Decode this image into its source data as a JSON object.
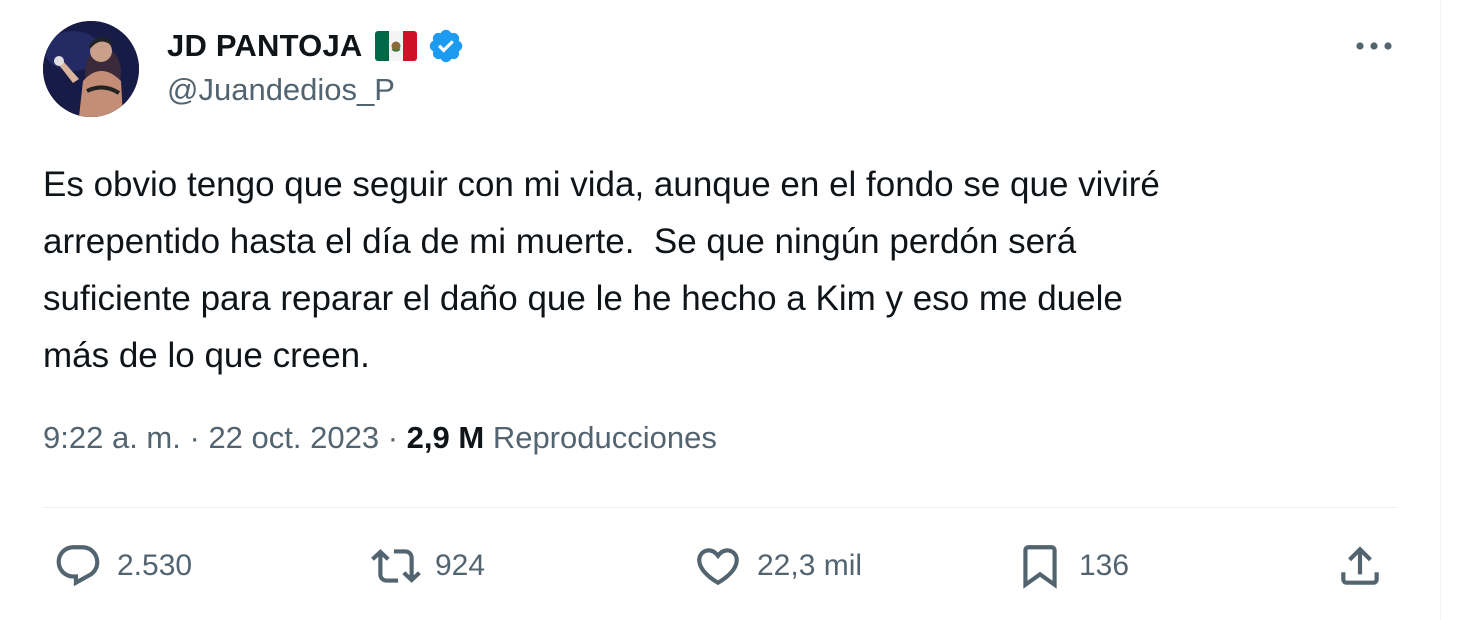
{
  "author": {
    "display_name": "JD PANTOJA",
    "flag_icon": "mexico-flag-icon",
    "verified_icon": "verified-badge-icon",
    "verified_color": "#1d9bf0",
    "handle": "@Juandedios_P"
  },
  "tweet": {
    "text": "Es obvio tengo que seguir con mi vida, aunque en el fondo se que viviré\narrepentido hasta el día de mi muerte.  Se que ningún perdón será\nsuficiente para reparar el daño que le he hecho a Kim y eso me duele\nmás de lo que creen."
  },
  "meta": {
    "time": "9:22 a. m.",
    "separator": "·",
    "date": "22 oct. 2023",
    "views_count": "2,9 M",
    "views_label": "Reproducciones"
  },
  "actions": {
    "replies": "2.530",
    "reposts": "924",
    "likes": "22,3 mil",
    "bookmarks": "136"
  },
  "colors": {
    "text_primary": "#0f1419",
    "text_secondary": "#536471",
    "divider": "#eff3f4"
  }
}
